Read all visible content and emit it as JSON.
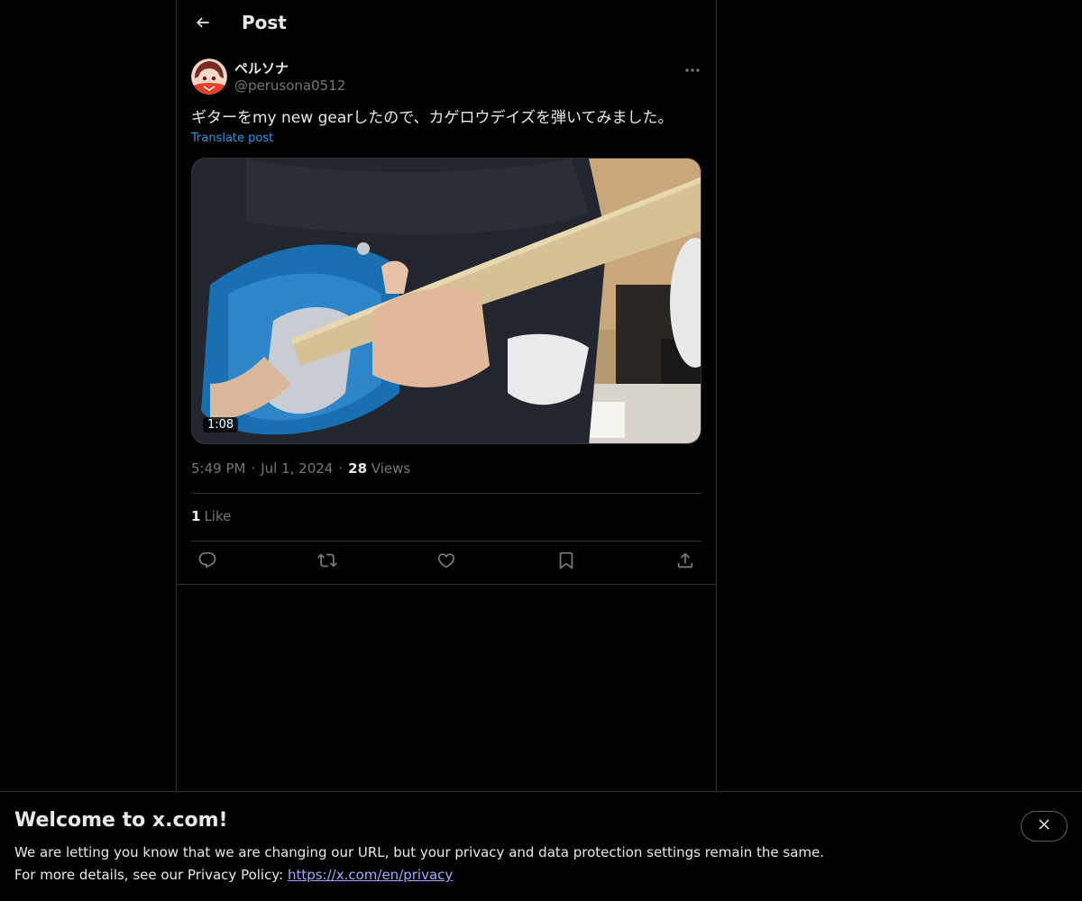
{
  "header": {
    "title": "Post"
  },
  "post": {
    "author_name": "ペルソナ",
    "author_handle": "@perusona0512",
    "text": "ギターをmy new gearしたので、カゲロウデイズを弾いてみました。",
    "translate_label": "Translate post",
    "media": {
      "duration": "1:08"
    },
    "time": "5:49 PM",
    "date": "Jul 1, 2024",
    "views_count": "28",
    "views_label": "Views",
    "likes_count": "1",
    "likes_label": "Like"
  },
  "icons": {
    "back": "arrow-left-icon",
    "more": "more-horizontal-icon",
    "reply": "reply-icon",
    "repost": "repost-icon",
    "like": "heart-icon",
    "bookmark": "bookmark-icon",
    "share": "share-icon",
    "close": "close-icon"
  },
  "banner": {
    "title": "Welcome to x.com!",
    "line1": "We are letting you know that we are changing our URL, but your privacy and data protection settings remain the same.",
    "line2_prefix": "For more details, see our Privacy Policy: ",
    "link_text": "https://x.com/en/privacy"
  },
  "colors": {
    "background": "#000000",
    "text": "#e7e9ea",
    "muted": "#71767b",
    "accent": "#1d9bf0",
    "border": "#2f3336"
  }
}
